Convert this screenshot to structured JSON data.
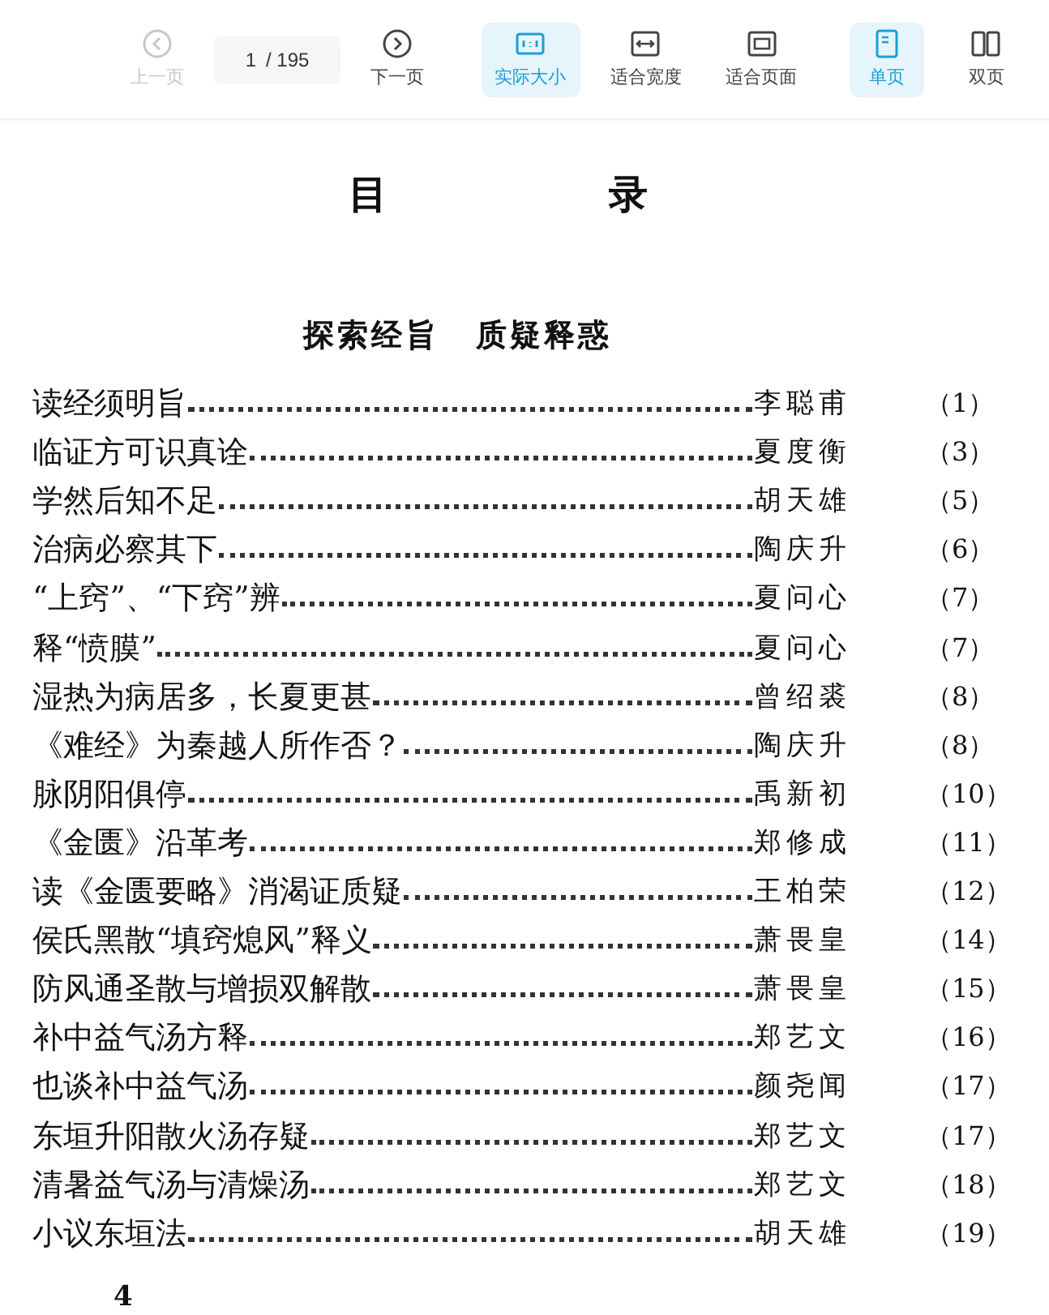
{
  "toolbar": {
    "prev": {
      "label": "上一页",
      "disabled": true
    },
    "page_field": {
      "value": "1",
      "total": "/ 195"
    },
    "next": {
      "label": "下一页",
      "disabled": false
    },
    "zoom_modes": [
      {
        "kind": "actual",
        "label": "实际大小",
        "selected": true
      },
      {
        "kind": "fit_width",
        "label": "适合宽度",
        "selected": false
      },
      {
        "kind": "fit_page",
        "label": "适合页面",
        "selected": false
      }
    ],
    "page_modes": [
      {
        "kind": "single",
        "label": "单页",
        "selected": true
      },
      {
        "kind": "double",
        "label": "双页",
        "selected": false
      }
    ]
  },
  "page": {
    "heading": "目 录",
    "section_title": "探索经旨 质疑释惑",
    "entries": [
      {
        "title": "读经须明旨",
        "author": "李聪甫",
        "page": "（1）"
      },
      {
        "title": "临证方可识真诠",
        "author": "夏度衡",
        "page": "（3）"
      },
      {
        "title": "学然后知不足",
        "author": "胡天雄",
        "page": "（5）"
      },
      {
        "title": "治病必察其下",
        "author": "陶庆升",
        "page": "（6）"
      },
      {
        "title": "“上窍”、“下窍”辨",
        "author": "夏问心",
        "page": "（7）"
      },
      {
        "title": "释“愤膜”",
        "author": "夏问心",
        "page": "（7）"
      },
      {
        "title": "湿热为病居多，长夏更甚",
        "author": "曾绍裘",
        "page": "（8）"
      },
      {
        "title": "《难经》为秦越人所作否？",
        "author": "陶庆升",
        "page": "（8）"
      },
      {
        "title": "脉阴阳俱停",
        "author": "禹新初",
        "page": "（10）"
      },
      {
        "title": "《金匮》沿革考",
        "author": "郑修成",
        "page": "（11）"
      },
      {
        "title": "读《金匮要略》消渴证质疑",
        "author": "王柏荣",
        "page": "（12）"
      },
      {
        "title": "侯氏黑散“填窍熄风”释义",
        "author": "萧畏皇",
        "page": "（14）"
      },
      {
        "title": "防风通圣散与增损双解散",
        "author": "萧畏皇",
        "page": "（15）"
      },
      {
        "title": "补中益气汤方释",
        "author": "郑艺文",
        "page": "（16）"
      },
      {
        "title": "也谈补中益气汤",
        "author": "颜尧闻",
        "page": "（17）"
      },
      {
        "title": "东垣升阳散火汤存疑",
        "author": "郑艺文",
        "page": "（17）"
      },
      {
        "title": "清暑益气汤与清燥汤",
        "author": "郑艺文",
        "page": "（18）"
      },
      {
        "title": "小议东垣法",
        "author": "胡天雄",
        "page": "（19）"
      }
    ],
    "page_number": "4"
  }
}
